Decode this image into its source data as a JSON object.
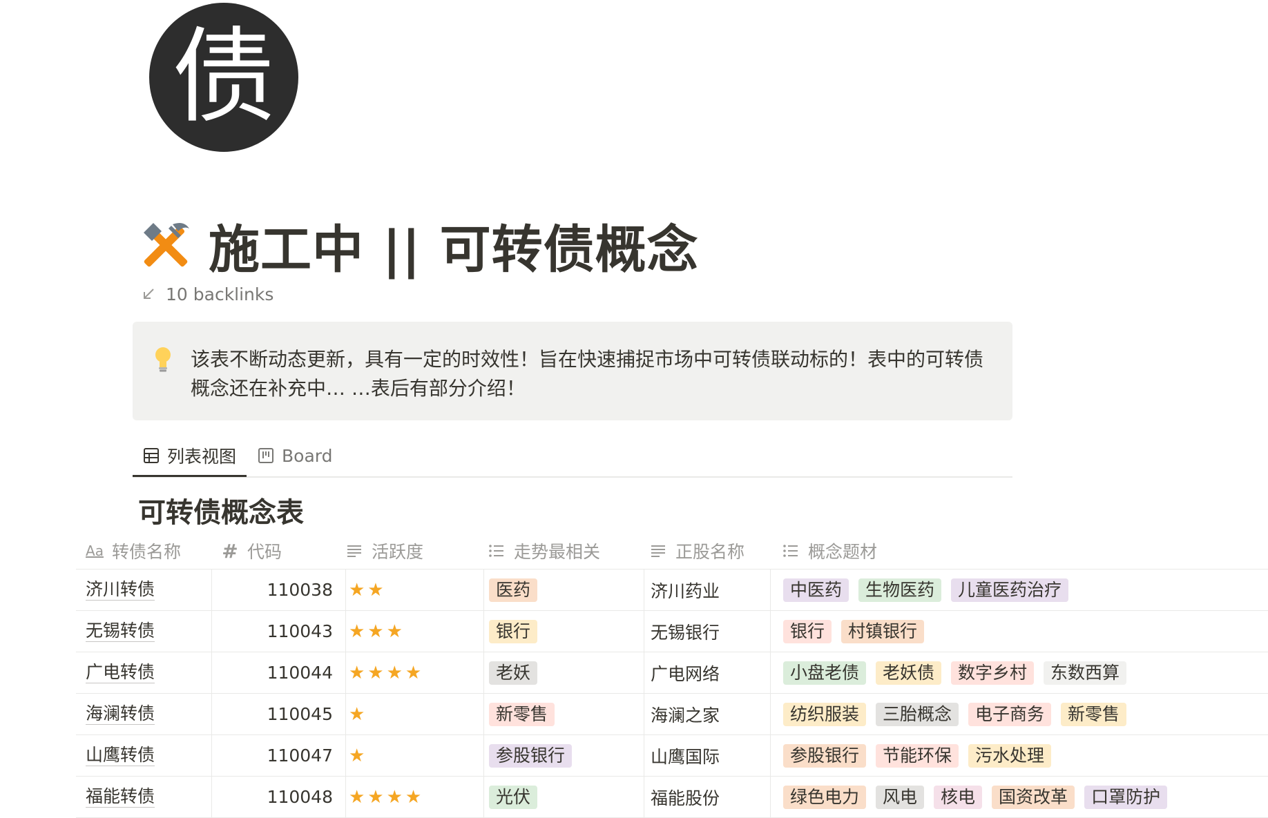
{
  "page": {
    "icon_char": "债",
    "title": "施工中 || 可转债概念",
    "backlinks": "10 backlinks",
    "callout": "该表不断动态更新，具有一定的时效性！旨在快速捕捉市场中可转债联动标的！表中的可转债概念还在补充中… …表后有部分介绍！"
  },
  "views": {
    "list_label": "列表视图",
    "board_label": "Board"
  },
  "database": {
    "title": "可转债概念表",
    "columns": {
      "name": "转债名称",
      "code": "代码",
      "activity": "活跃度",
      "trend": "走势最相关",
      "stock": "正股名称",
      "concepts": "概念题材"
    },
    "rows": [
      {
        "name": "济川转债",
        "code": "110038",
        "stars": "★★",
        "rating": 2,
        "trend": {
          "text": "医药",
          "color": "#fadec9"
        },
        "stock": "济川药业",
        "tags": [
          {
            "text": "中医药",
            "color": "#e8deee"
          },
          {
            "text": "生物医药",
            "color": "#dbeddb"
          },
          {
            "text": "儿童医药治疗",
            "color": "#e8deee"
          }
        ]
      },
      {
        "name": "无锡转债",
        "code": "110043",
        "stars": "★★★",
        "rating": 3,
        "trend": {
          "text": "银行",
          "color": "#fdecc8"
        },
        "stock": "无锡银行",
        "tags": [
          {
            "text": "银行",
            "color": "#ffe2dd"
          },
          {
            "text": "村镇银行",
            "color": "#fadec9"
          }
        ]
      },
      {
        "name": "广电转债",
        "code": "110044",
        "stars": "★★★★",
        "rating": 4,
        "trend": {
          "text": "老妖",
          "color": "#e3e2e0"
        },
        "stock": "广电网络",
        "tags": [
          {
            "text": "小盘老债",
            "color": "#dbeddb"
          },
          {
            "text": "老妖债",
            "color": "#fdecc8"
          },
          {
            "text": "数字乡村",
            "color": "#ffe2dd"
          },
          {
            "text": "东数西算",
            "color": "#f1f1ef"
          }
        ]
      },
      {
        "name": "海澜转债",
        "code": "110045",
        "stars": "★",
        "rating": 1,
        "trend": {
          "text": "新零售",
          "color": "#ffe2dd"
        },
        "stock": "海澜之家",
        "tags": [
          {
            "text": "纺织服装",
            "color": "#fdecc8"
          },
          {
            "text": "三胎概念",
            "color": "#e3e2e0"
          },
          {
            "text": "电子商务",
            "color": "#ffe2dd"
          },
          {
            "text": "新零售",
            "color": "#fdecc8"
          }
        ]
      },
      {
        "name": "山鹰转债",
        "code": "110047",
        "stars": "★",
        "rating": 1,
        "trend": {
          "text": "参股银行",
          "color": "#e8deee"
        },
        "stock": "山鹰国际",
        "tags": [
          {
            "text": "参股银行",
            "color": "#fadec9"
          },
          {
            "text": "节能环保",
            "color": "#ffe2dd"
          },
          {
            "text": "污水处理",
            "color": "#fdecc8"
          }
        ]
      },
      {
        "name": "福能转债",
        "code": "110048",
        "stars": "★★★★",
        "rating": 4,
        "trend": {
          "text": "光伏",
          "color": "#dbeddb"
        },
        "stock": "福能股份",
        "tags": [
          {
            "text": "绿色电力",
            "color": "#fadec9"
          },
          {
            "text": "风电",
            "color": "#e3e2e0"
          },
          {
            "text": "核电",
            "color": "#f5e0e9"
          },
          {
            "text": "国资改革",
            "color": "#fadec9"
          },
          {
            "text": "口罩防护",
            "color": "#e8deee"
          }
        ]
      }
    ]
  }
}
